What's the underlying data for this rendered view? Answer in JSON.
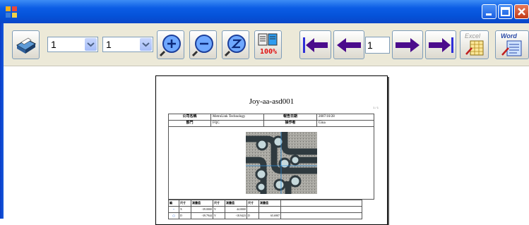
{
  "window": {
    "icon": "app-icon"
  },
  "toolbar": {
    "print_icon": "printer-icon",
    "page_combo_1": "1",
    "page_combo_2": "1",
    "zoom_in_icon": "zoom-in-icon",
    "zoom_out_icon": "zoom-out-icon",
    "zoom_reset_icon": "zoom-reset-icon",
    "zoom_label": "100%",
    "current_page": "1",
    "excel_label": "Excel",
    "word_label": "Word"
  },
  "report": {
    "title": "Joy-aa-asd001",
    "page_indicator": "1 / 1",
    "header_rows": [
      [
        "公司名稱",
        "MetroLink Technology",
        "報告日期",
        "2007/10/28"
      ],
      [
        "部門",
        "FQC",
        "操作者",
        "Gina"
      ]
    ],
    "table_headers": [
      "編",
      "尺寸",
      "測量值",
      "尺寸",
      "測量值",
      "尺寸",
      "測量值"
    ],
    "table_rows": [
      [
        "+",
        "X",
        "-39.0000",
        "Y",
        "44.0000",
        "",
        ""
      ],
      [
        "○",
        "D",
        "-39.7944",
        "Y",
        "-18.9423",
        "D",
        "65.6907"
      ]
    ]
  },
  "colors": {
    "titlebar": "#0b5ce5",
    "toolbar_bg": "#ece9d8",
    "arrow": "#4b0b8c",
    "arrow_accent": "#2f2fd8",
    "close": "#c23a16"
  }
}
